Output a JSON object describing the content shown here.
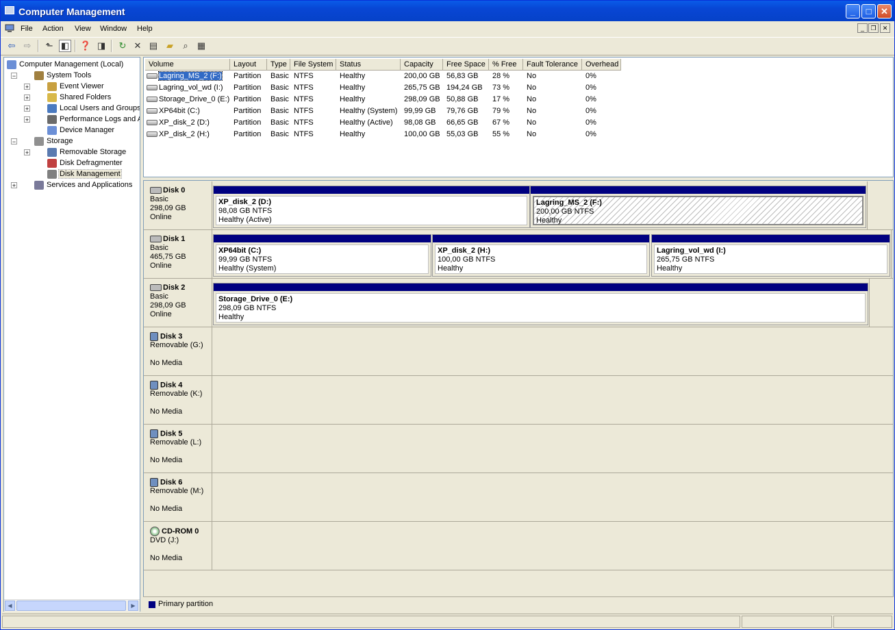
{
  "window": {
    "title": "Computer Management"
  },
  "menu": [
    "File",
    "Action",
    "View",
    "Window",
    "Help"
  ],
  "tree": [
    {
      "label": "Computer Management (Local)",
      "level": 0,
      "icon": "computer-icon",
      "expander": ""
    },
    {
      "label": "System Tools",
      "level": 1,
      "icon": "tools-icon",
      "expander": "−"
    },
    {
      "label": "Event Viewer",
      "level": 2,
      "icon": "event-viewer-icon",
      "expander": "+"
    },
    {
      "label": "Shared Folders",
      "level": 2,
      "icon": "shared-folders-icon",
      "expander": "+"
    },
    {
      "label": "Local Users and Groups",
      "level": 2,
      "icon": "users-icon",
      "expander": "+"
    },
    {
      "label": "Performance Logs and Alerts",
      "level": 2,
      "icon": "performance-icon",
      "expander": "+"
    },
    {
      "label": "Device Manager",
      "level": 2,
      "icon": "device-manager-icon",
      "expander": ""
    },
    {
      "label": "Storage",
      "level": 1,
      "icon": "storage-icon",
      "expander": "−"
    },
    {
      "label": "Removable Storage",
      "level": 2,
      "icon": "removable-storage-icon",
      "expander": "+"
    },
    {
      "label": "Disk Defragmenter",
      "level": 2,
      "icon": "defragmenter-icon",
      "expander": ""
    },
    {
      "label": "Disk Management",
      "level": 2,
      "icon": "disk-management-icon",
      "expander": "",
      "selected": true
    },
    {
      "label": "Services and Applications",
      "level": 1,
      "icon": "services-icon",
      "expander": "+"
    }
  ],
  "columns": [
    "Volume",
    "Layout",
    "Type",
    "File System",
    "Status",
    "Capacity",
    "Free Space",
    "% Free",
    "Fault Tolerance",
    "Overhead"
  ],
  "volumes": [
    [
      "Lagring_MS_2 (F:)",
      "Partition",
      "Basic",
      "NTFS",
      "Healthy",
      "200,00 GB",
      "56,83 GB",
      "28 %",
      "No",
      "0%"
    ],
    [
      "Lagring_vol_wd (I:)",
      "Partition",
      "Basic",
      "NTFS",
      "Healthy",
      "265,75 GB",
      "194,24 GB",
      "73 %",
      "No",
      "0%"
    ],
    [
      "Storage_Drive_0 (E:)",
      "Partition",
      "Basic",
      "NTFS",
      "Healthy",
      "298,09 GB",
      "50,88 GB",
      "17 %",
      "No",
      "0%"
    ],
    [
      "XP64bit (C:)",
      "Partition",
      "Basic",
      "NTFS",
      "Healthy (System)",
      "99,99 GB",
      "79,76 GB",
      "79 %",
      "No",
      "0%"
    ],
    [
      "XP_disk_2 (D:)",
      "Partition",
      "Basic",
      "NTFS",
      "Healthy (Active)",
      "98,08 GB",
      "66,65 GB",
      "67 %",
      "No",
      "0%"
    ],
    [
      "XP_disk_2 (H:)",
      "Partition",
      "Basic",
      "NTFS",
      "Healthy",
      "100,00 GB",
      "55,03 GB",
      "55 %",
      "No",
      "0%"
    ]
  ],
  "disks": [
    {
      "name": "Disk 0",
      "kind": "disk",
      "line1": "Basic",
      "line2": "298,09 GB",
      "line3": "Online",
      "partitions": [
        {
          "name": "XP_disk_2  (D:)",
          "size": "98,08 GB NTFS",
          "status": "Healthy (Active)"
        },
        {
          "name": "Lagring_MS_2  (F:)",
          "size": "200,00 GB NTFS",
          "status": "Healthy",
          "selected": true
        }
      ]
    },
    {
      "name": "Disk 1",
      "kind": "disk",
      "line1": "Basic",
      "line2": "465,75 GB",
      "line3": "Online",
      "partitions": [
        {
          "name": "XP64bit  (C:)",
          "size": "99,99 GB NTFS",
          "status": "Healthy (System)"
        },
        {
          "name": "XP_disk_2  (H:)",
          "size": "100,00 GB NTFS",
          "status": "Healthy"
        },
        {
          "name": "Lagring_vol_wd  (I:)",
          "size": "265,75 GB NTFS",
          "status": "Healthy"
        }
      ]
    },
    {
      "name": "Disk 2",
      "kind": "disk",
      "line1": "Basic",
      "line2": "298,09 GB",
      "line3": "Online",
      "partitions": [
        {
          "name": "Storage_Drive_0  (E:)",
          "size": "298,09 GB NTFS",
          "status": "Healthy"
        }
      ]
    },
    {
      "name": "Disk 3",
      "kind": "removable",
      "line1": "Removable (G:)",
      "line2": "",
      "line3": "No Media",
      "partitions": []
    },
    {
      "name": "Disk 4",
      "kind": "removable",
      "line1": "Removable (K:)",
      "line2": "",
      "line3": "No Media",
      "partitions": []
    },
    {
      "name": "Disk 5",
      "kind": "removable",
      "line1": "Removable (L:)",
      "line2": "",
      "line3": "No Media",
      "partitions": []
    },
    {
      "name": "Disk 6",
      "kind": "removable",
      "line1": "Removable (M:)",
      "line2": "",
      "line3": "No Media",
      "partitions": []
    },
    {
      "name": "CD-ROM 0",
      "kind": "cdrom",
      "line1": "DVD (J:)",
      "line2": "",
      "line3": "No Media",
      "partitions": []
    }
  ],
  "legend": {
    "label": "Primary partition",
    "color": "#000080"
  },
  "colors": {
    "title_bar": "#0846d4",
    "partition_bar": "#000080",
    "selection": "#316ac5"
  }
}
